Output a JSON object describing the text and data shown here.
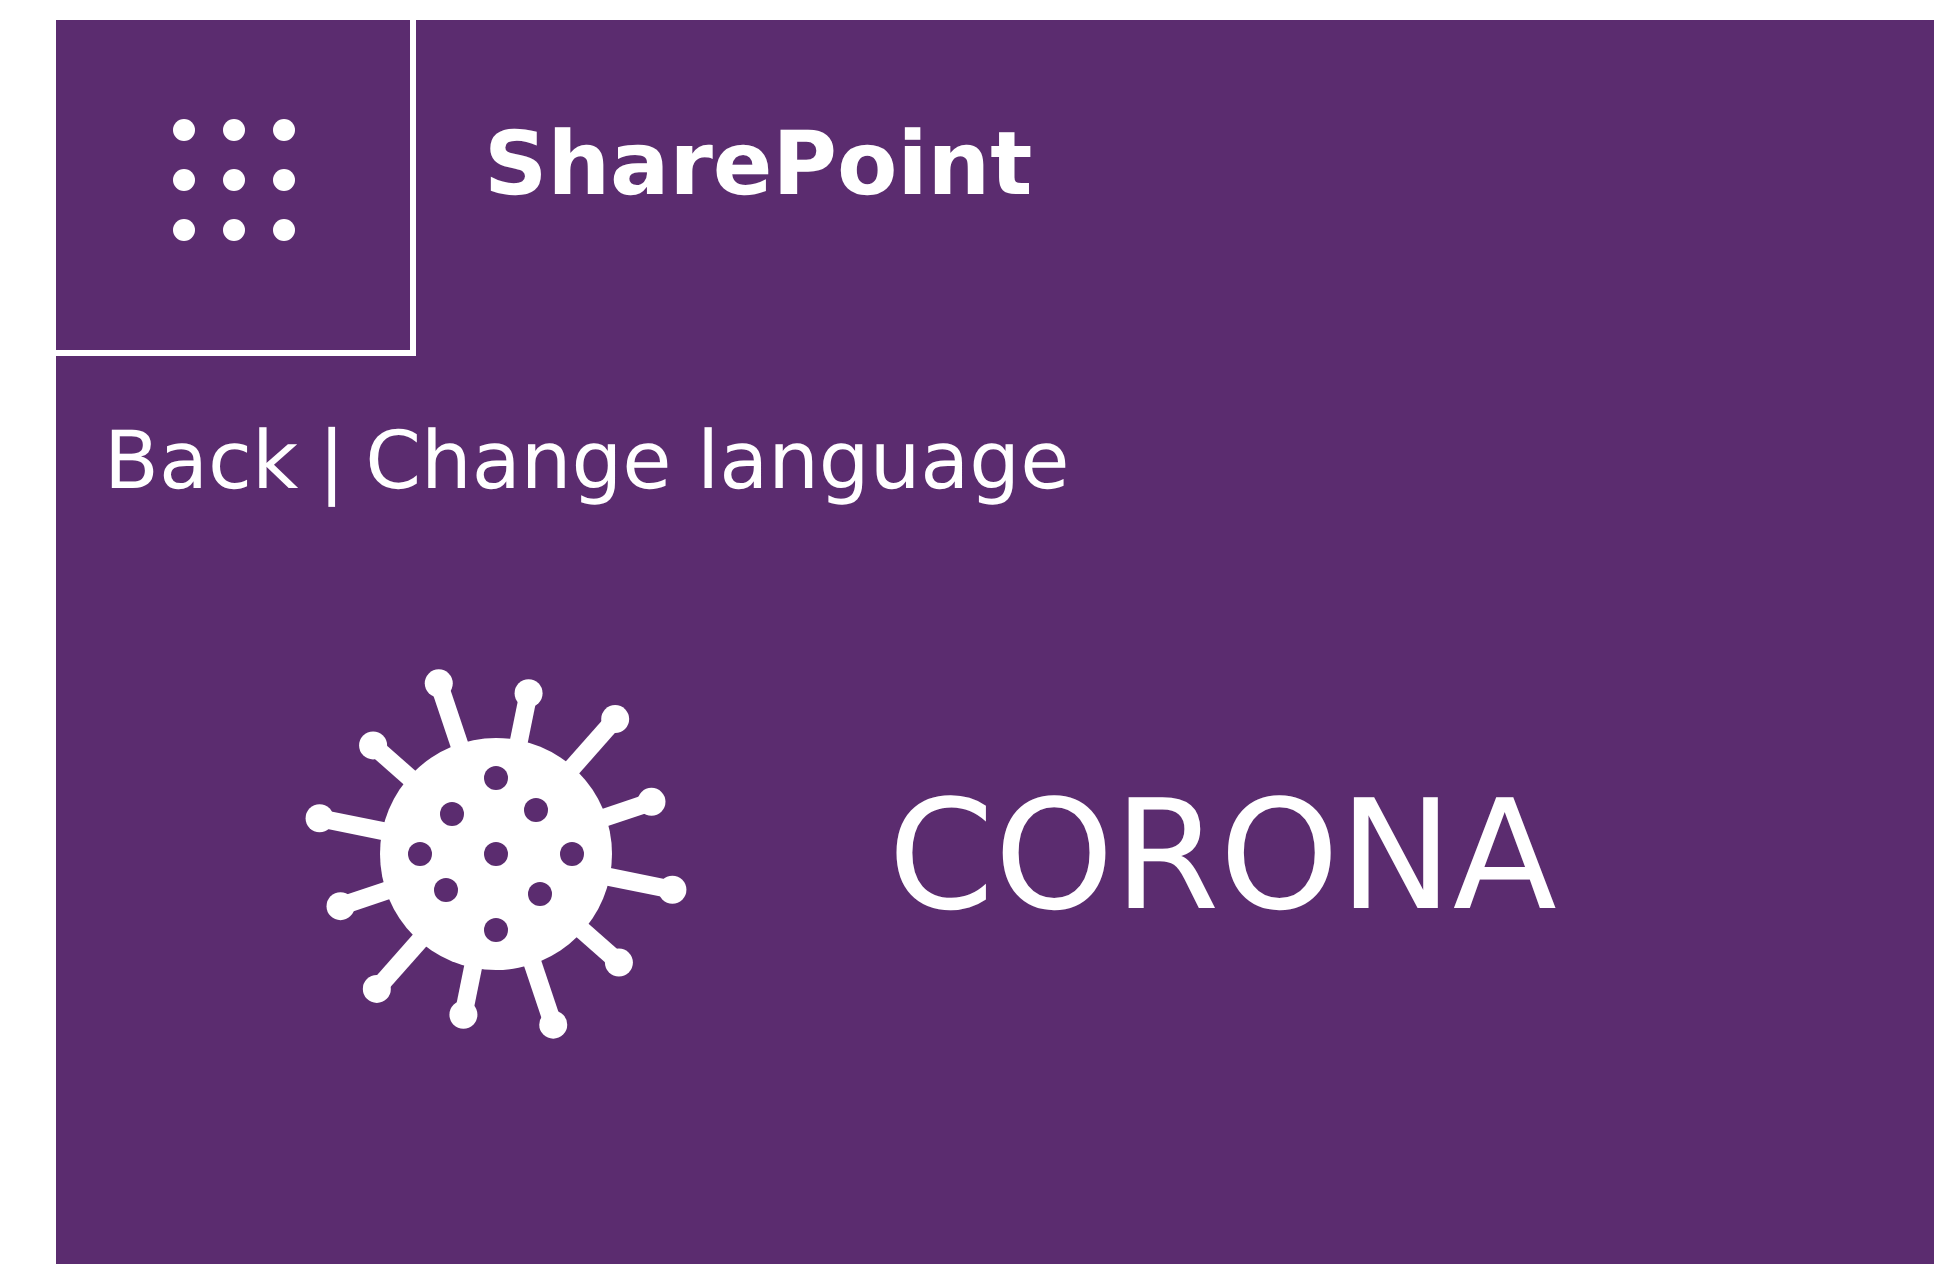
{
  "app_bar": {
    "title": "SharePoint"
  },
  "nav_links": [
    {
      "label": "Back"
    },
    {
      "label": "Change language"
    }
  ],
  "separator": "|",
  "banner": {
    "title": "CORONA"
  }
}
